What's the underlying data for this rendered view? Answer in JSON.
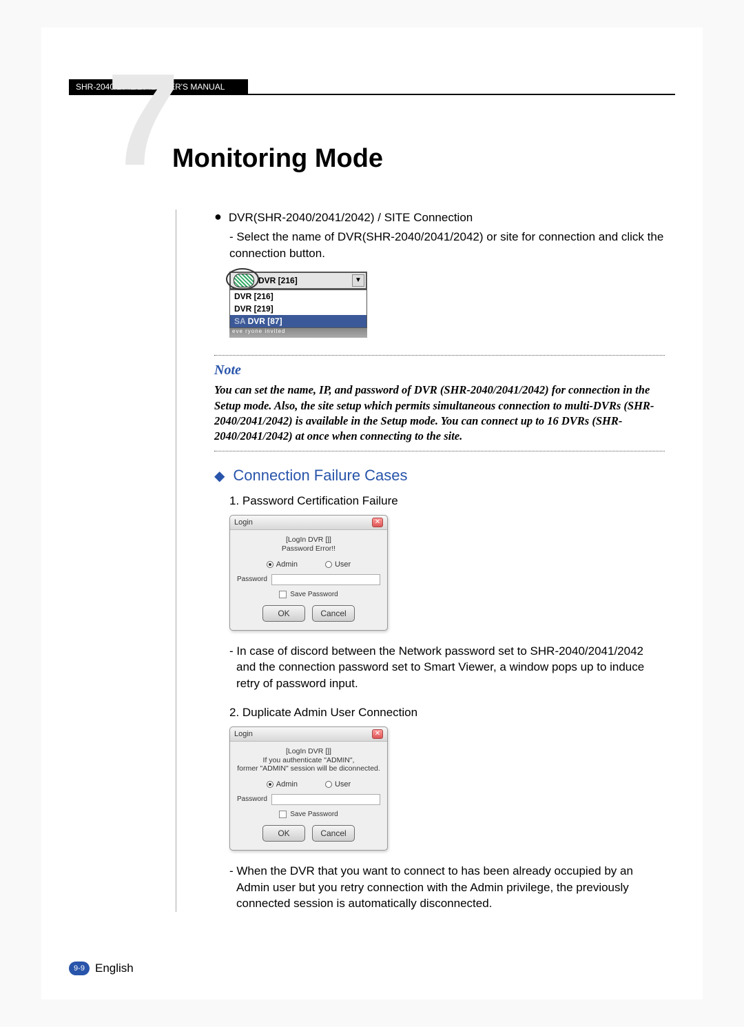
{
  "header": {
    "doc_title": "SHR-2040/2041/2042 USER'S MANUAL"
  },
  "chapter": {
    "number": "7",
    "title": "Monitoring Mode"
  },
  "bullet": {
    "title": "DVR(SHR-2040/2041/2042) / SITE Connection",
    "sub": "- Select the name of DVR(SHR-2040/2041/2042) or site for connection and click the connection button."
  },
  "combo": {
    "selected": "DVR [216]",
    "items": [
      "DVR [216]",
      "DVR [219]",
      "DVR [87]"
    ],
    "watermark_left": "SA",
    "strip": "eve ryone  invited"
  },
  "note": {
    "heading": "Note",
    "body": "You can set the name, IP, and password of DVR (SHR-2040/2041/2042) for connection in the Setup mode. Also, the site setup which permits simultaneous connection to multi-DVRs (SHR-2040/2041/2042) is available in the Setup mode. You can connect up to 16 DVRs (SHR-2040/2041/2042) at once when connecting to the site."
  },
  "section": {
    "title": "Connection Failure Cases"
  },
  "case1": {
    "num_label": "1. Password Certification Failure",
    "login_title": "Login",
    "msg_line1": "[LogIn DVR []]",
    "msg_line2": "Password Error!!",
    "radio_admin": "Admin",
    "radio_user": "User",
    "pw_label": "Password",
    "save_pw": "Save Password",
    "ok": "OK",
    "cancel": "Cancel",
    "para": "- In case of discord between the Network password set to SHR-2040/2041/2042 and the connection password set to Smart Viewer, a window pops up to induce retry of password input."
  },
  "case2": {
    "num_label": "2. Duplicate Admin User Connection",
    "login_title": "Login",
    "msg_line1": "[LogIn DVR []]",
    "msg_line2": "If you authenticate \"ADMIN\",",
    "msg_line3": "former \"ADMIN\" session will be diconnected.",
    "radio_admin": "Admin",
    "radio_user": "User",
    "pw_label": "Password",
    "save_pw": "Save Password",
    "ok": "OK",
    "cancel": "Cancel",
    "para": "- When the DVR that you want to connect to has been already occupied by an Admin user but you retry connection with the Admin privilege, the previously connected session is automatically disconnected."
  },
  "footer": {
    "page": "9-9",
    "lang": "English"
  }
}
